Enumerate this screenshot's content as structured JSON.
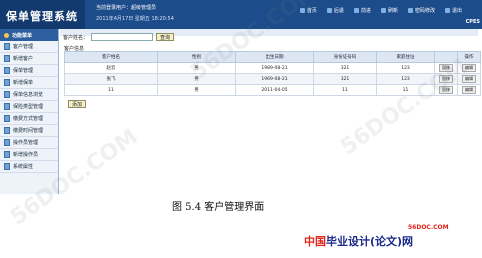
{
  "header": {
    "app_title": "保单管理系统",
    "user_text": "当前登录用户：超级管理员",
    "date_text": "2011年4月17日 星期五 18:20:54",
    "brand_corner": "CPES",
    "nav": [
      "首页",
      "后退",
      "前进",
      "刷新",
      "密码修改",
      "退出"
    ]
  },
  "sidebar": {
    "title": "功能菜单",
    "items": [
      "客户管理",
      "新增客户",
      "保单管理",
      "新增保单",
      "保单信息浏览",
      "保险类型管理",
      "缴费方式管理",
      "缴费时间管理",
      "操作员管理",
      "新增操作员",
      "系统属性"
    ]
  },
  "main": {
    "search_label": "客户姓名：",
    "search_value": "",
    "search_button": "查询",
    "panel_title": "客户信息",
    "columns": [
      "客户姓名",
      "性别",
      "出生日期",
      "身份证号码",
      "家庭住址",
      "",
      "操作"
    ],
    "rows": [
      [
        "赵云",
        "男",
        "1989-08-21",
        "321",
        "123",
        "国移",
        "编辑"
      ],
      [
        "张飞",
        "男",
        "1969-08-21",
        "321",
        "123",
        "国移",
        "编辑"
      ],
      [
        "11",
        "男",
        "2011-04-05",
        "11",
        "11",
        "国移",
        "编辑"
      ]
    ],
    "add_button": "添加"
  },
  "caption": "图 5.4 客户管理界面",
  "footer": {
    "brand_prefix": "中国",
    "brand_main": "毕业设计(论文)网",
    "site": "56DOC.COM"
  },
  "watermark": "56DOC.COM"
}
